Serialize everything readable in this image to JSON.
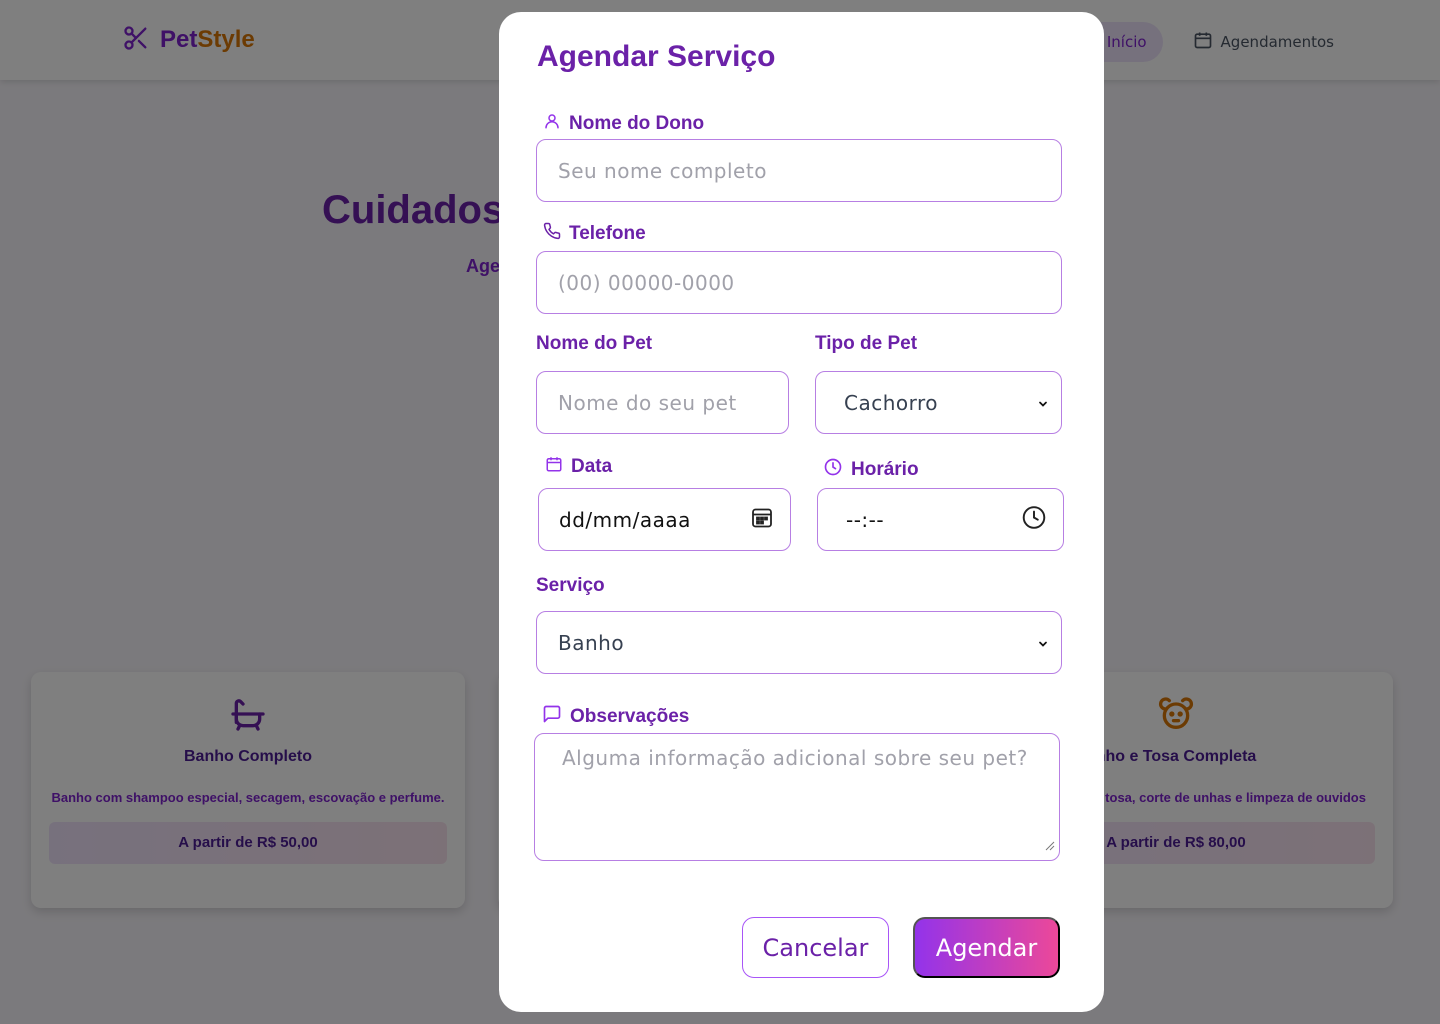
{
  "nav": {
    "brand_part1": "Pet",
    "brand_part2": "Style",
    "links": [
      {
        "label": "Início",
        "icon": "home-icon",
        "active": true
      },
      {
        "label": "Agendamentos",
        "icon": "calendar-icon",
        "active": false
      }
    ]
  },
  "hero": {
    "title_visible_left": "Cuidados",
    "title_visible_right": "n",
    "subtitle_visible": "Age"
  },
  "services": [
    {
      "icon": "bathtub-icon",
      "title": "Banho Completo",
      "description": "Banho com shampoo especial, secagem, escovação e perfume.",
      "price": "A partir de R$ 50,00"
    },
    {
      "icon": "dog-icon",
      "title": "nho e Tosa Completa",
      "description": "o incluindo banho, tosa, corte de unhas e limpeza de ouvidos",
      "price": "A partir de R$ 80,00"
    }
  ],
  "modal": {
    "title": "Agendar Serviço",
    "owner": {
      "label": "Nome do Dono",
      "placeholder": "Seu nome completo"
    },
    "phone": {
      "label": "Telefone",
      "placeholder": "(00) 00000-0000"
    },
    "pet_name": {
      "label": "Nome do Pet",
      "placeholder": "Nome do seu pet"
    },
    "pet_type": {
      "label": "Tipo de Pet",
      "value": "Cachorro"
    },
    "date": {
      "label": "Data",
      "placeholder": "dd/mm/aaaa"
    },
    "time": {
      "label": "Horário",
      "placeholder": "--:--"
    },
    "service": {
      "label": "Serviço",
      "value": "Banho"
    },
    "notes": {
      "label": "Observações",
      "placeholder": "Alguma informação adicional sobre seu pet?"
    },
    "cancel_label": "Cancelar",
    "submit_label": "Agendar"
  },
  "colors": {
    "primary": "#6b21a8",
    "accent": "#a855f7",
    "gradient_start": "#9333ea",
    "gradient_end": "#ec4899",
    "overlay": "rgba(0,0,0,0.5)"
  }
}
